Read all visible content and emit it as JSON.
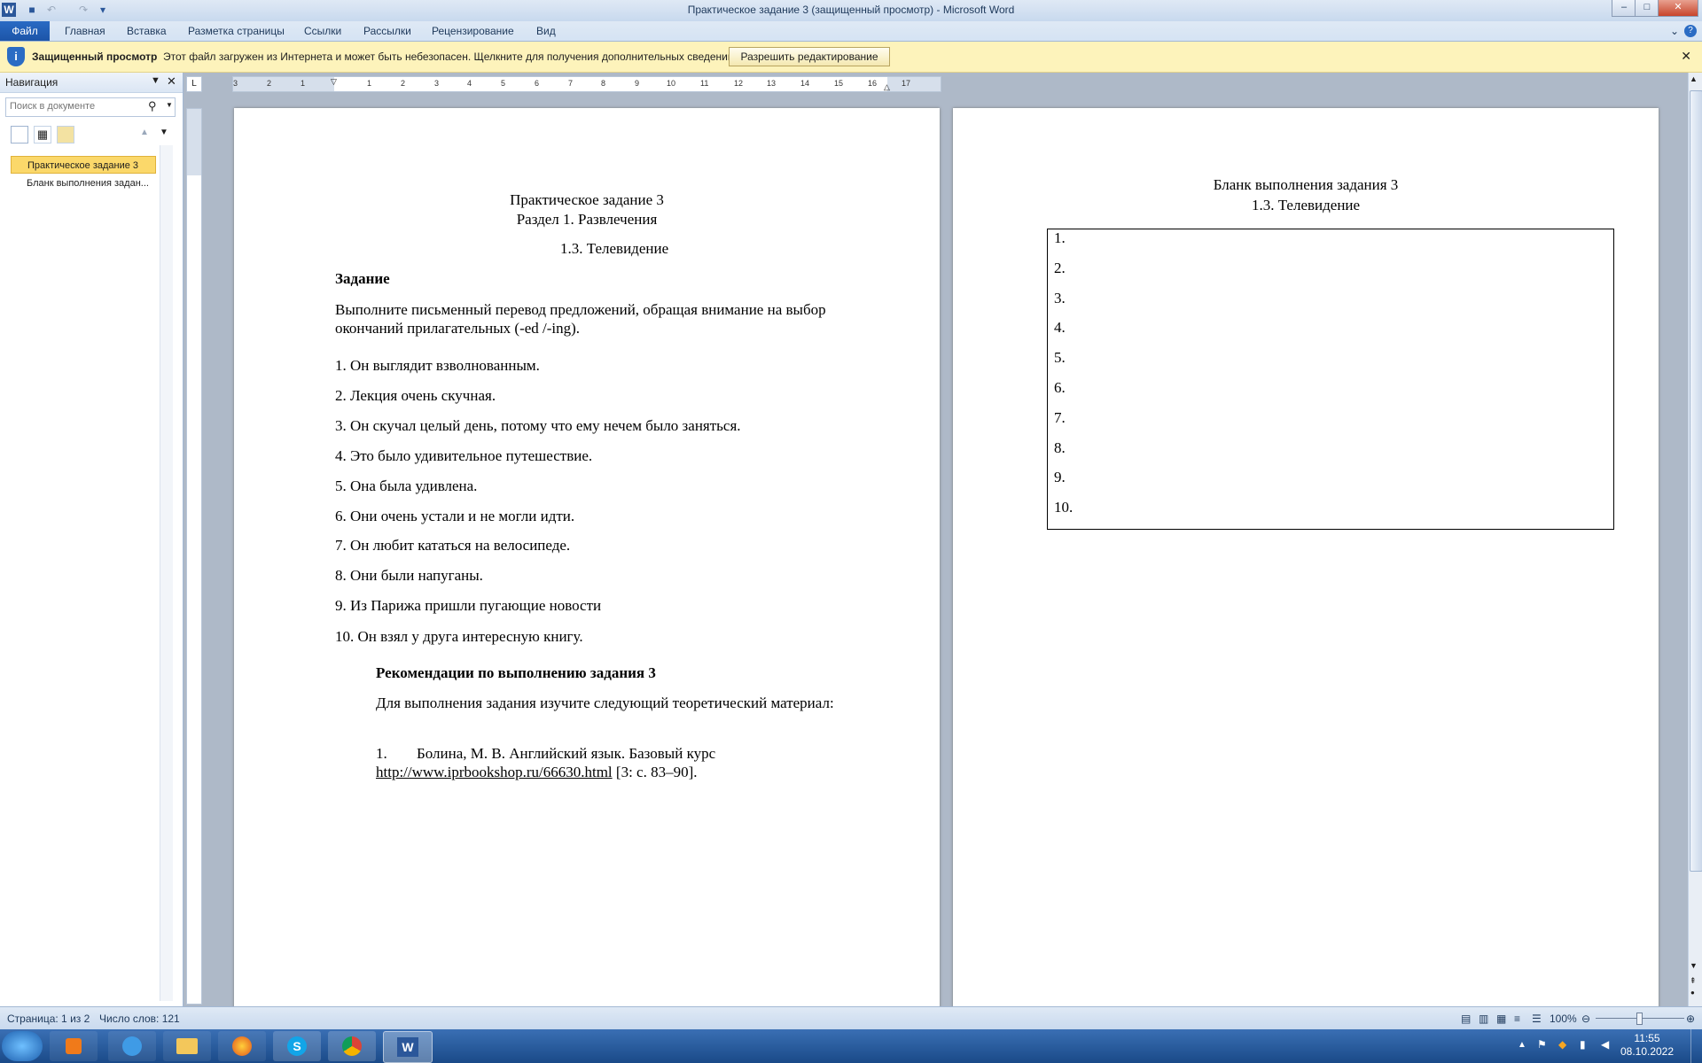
{
  "window": {
    "title": "Практическое задание 3 (защищенный просмотр)  -  Microsoft Word"
  },
  "ribbon": {
    "file_tab": "Файл",
    "tabs": [
      "Главная",
      "Вставка",
      "Разметка страницы",
      "Ссылки",
      "Рассылки",
      "Рецензирование",
      "Вид"
    ]
  },
  "protected_view": {
    "title": "Защищенный просмотр",
    "message": "Этот файл загружен из Интернета и может быть небезопасен. Щелкните для получения дополнительных сведений.",
    "button": "Разрешить редактирование"
  },
  "navigation": {
    "title": "Навигация",
    "search_placeholder": "Поиск в документе",
    "items": [
      "Практическое задание 3",
      "Бланк выполнения задан..."
    ]
  },
  "ruler": {
    "labels": [
      "3",
      "2",
      "1",
      "1",
      "2",
      "3",
      "4",
      "5",
      "6",
      "7",
      "8",
      "9",
      "10",
      "11",
      "12",
      "13",
      "14",
      "15",
      "16",
      "17"
    ]
  },
  "page1": {
    "title1": "Практическое задание 3",
    "title2": "Раздел 1. Развлечения",
    "title3": "1.3. Телевидение",
    "task_heading": "Задание",
    "instruction_line1": "Выполните письменный перевод предложений, обращая внимание на выбор",
    "instruction_line2": "окончаний прилагательных (-ed /-ing).",
    "sentences": [
      "1. Он выглядит взволнованным.",
      "2. Лекция очень скучная.",
      "3. Он скучал целый день, потому что ему нечем было заняться.",
      "4.  Это было удивительное путешествие.",
      "5. Она была удивлена.",
      "6. Они очень устали и не могли идти.",
      "7. Он любит кататься на велосипеде.",
      "8. Они были напуганы.",
      "9. Из Парижа пришли пугающие новости",
      "10. Он взял у друга интересную книгу."
    ],
    "recommendations_heading": "Рекомендации по выполнению задания 3",
    "recommendations_text": "Для выполнения задания изучите следующий теоретический материал:",
    "ref_number": "1.",
    "ref_text": "Болина, М. В. Английский язык. Базовый курс",
    "ref_link": "http://www.iprbookshop.ru/66630.html",
    "ref_pages": " [3: с. 83–90]."
  },
  "page2": {
    "title1": "Бланк выполнения задания 3",
    "title2": "1.3. Телевидение",
    "rows": [
      "1.",
      "2.",
      "3.",
      "4.",
      "5.",
      "6.",
      "7.",
      "8.",
      "9.",
      "10."
    ]
  },
  "status": {
    "page": "Страница: 1 из 2",
    "words": "Число слов: 121",
    "zoom": "100%"
  },
  "taskbar": {
    "time": "11:55",
    "date": "08.10.2022"
  },
  "colors": {
    "accent": "#2b579a",
    "protected_bar": "#fdf3bb",
    "nav_selected": "#fbd86a"
  }
}
